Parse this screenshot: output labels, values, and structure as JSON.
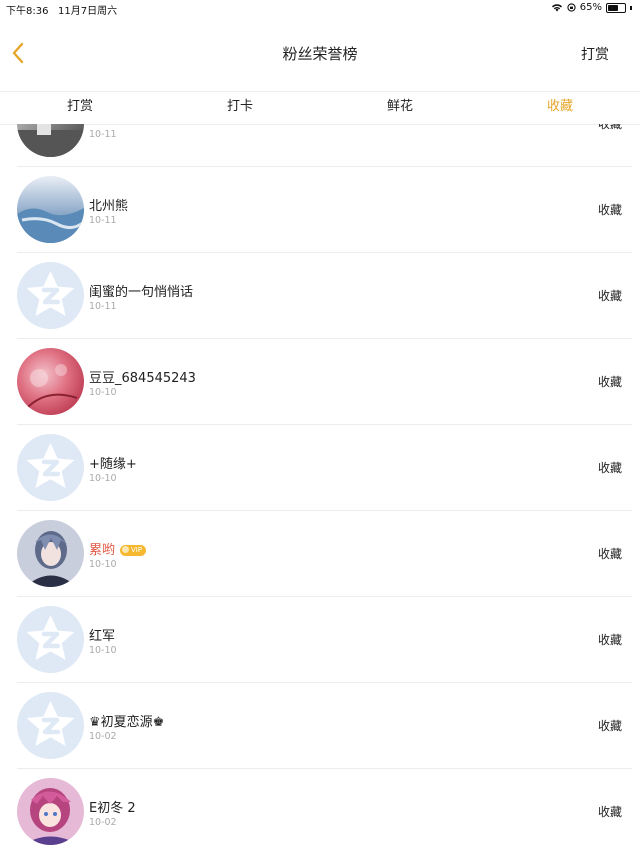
{
  "status_bar": {
    "time_date": "下午8:36   11月7日周六",
    "battery": "65%",
    "battery_level": 0.65
  },
  "nav": {
    "title": "粉丝荣誉榜",
    "action": "打赏",
    "back_icon": "chevron-left-icon"
  },
  "tabs": [
    {
      "label": "打赏",
      "active": false
    },
    {
      "label": "打卡",
      "active": false
    },
    {
      "label": "鲜花",
      "active": false
    },
    {
      "label": "收藏",
      "active": true
    }
  ],
  "colors": {
    "accent": "#e4a62a",
    "vip_name": "#e05a45",
    "vip_badge": "#f5b82e",
    "divider": "#ececec",
    "date_text": "#aaaaaa"
  },
  "items": [
    {
      "name": "",
      "date": "10-11",
      "action": "收藏",
      "avatar": "gray-photo"
    },
    {
      "name": "北州熊",
      "date": "10-11",
      "action": "收藏",
      "avatar": "snow-landscape"
    },
    {
      "name": "闺蜜的一句悄悄话",
      "date": "10-11",
      "action": "收藏",
      "avatar": "default-star"
    },
    {
      "name": "豆豆_684545243",
      "date": "10-10",
      "action": "收藏",
      "avatar": "pink-blossom"
    },
    {
      "name": "+随缘+",
      "date": "10-10",
      "action": "收藏",
      "avatar": "default-star"
    },
    {
      "name": "累哟",
      "date": "10-10",
      "action": "收藏",
      "avatar": "anime-character",
      "vip": true,
      "vip_label": "VIP"
    },
    {
      "name": "红军",
      "date": "10-10",
      "action": "收藏",
      "avatar": "default-star"
    },
    {
      "name": "♛初夏恋源♚",
      "date": "10-02",
      "action": "收藏",
      "avatar": "default-star"
    },
    {
      "name": "E初冬 2",
      "date": "10-02",
      "action": "收藏",
      "avatar": "anime-girl"
    }
  ]
}
